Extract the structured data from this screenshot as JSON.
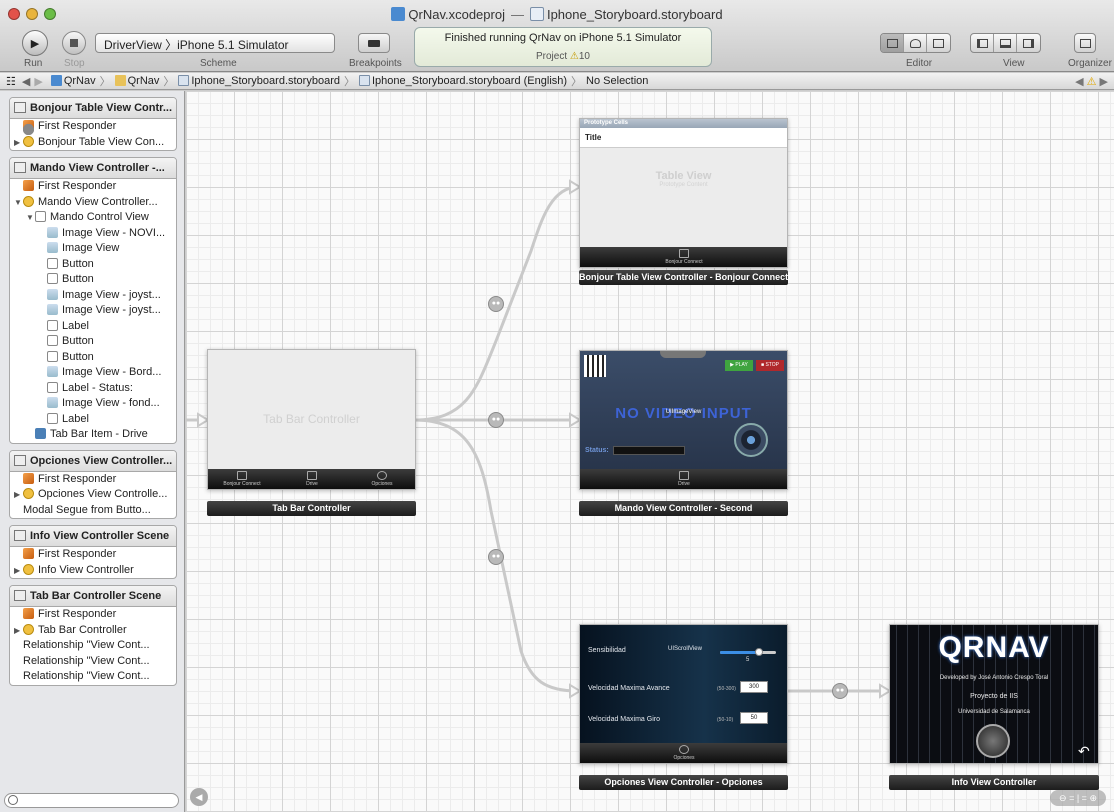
{
  "window": {
    "title_project": "QrNav.xcodeproj",
    "title_separator": "—",
    "title_file": "Iphone_Storyboard.storyboard"
  },
  "toolbar": {
    "run_label": "Run",
    "stop_label": "Stop",
    "scheme_value": "DriverView 〉iPhone 5.1 Simulator",
    "scheme_label": "Scheme",
    "breakpoints_label": "Breakpoints",
    "activity_status": "Finished running QrNav on iPhone 5.1 Simulator",
    "activity_project": "Project",
    "activity_warnings": "10",
    "editor_label": "Editor",
    "view_label": "View",
    "organizer_label": "Organizer"
  },
  "jumpbar": {
    "items": [
      "QrNav",
      "QrNav",
      "Iphone_Storyboard.storyboard",
      "Iphone_Storyboard.storyboard (English)",
      "No Selection"
    ]
  },
  "outline": [
    {
      "title": "Bonjour Table View Contr...",
      "rows": [
        {
          "label": "First Responder",
          "icon": "cube",
          "indent": 0,
          "disclosure": ""
        },
        {
          "label": "Bonjour Table View Con...",
          "icon": "circle",
          "indent": 0,
          "disclosure": "▶"
        }
      ]
    },
    {
      "title": "Mando View Controller -...",
      "rows": [
        {
          "label": "First Responder",
          "icon": "cube",
          "indent": 0,
          "disclosure": ""
        },
        {
          "label": "Mando View Controller...",
          "icon": "circle",
          "indent": 0,
          "disclosure": "▼"
        },
        {
          "label": "Mando Control View",
          "icon": "box",
          "indent": 1,
          "disclosure": "▼"
        },
        {
          "label": "Image View - NOVI...",
          "icon": "image",
          "indent": 2,
          "disclosure": ""
        },
        {
          "label": "Image View",
          "icon": "image",
          "indent": 2,
          "disclosure": ""
        },
        {
          "label": "Button",
          "icon": "box",
          "indent": 2,
          "disclosure": ""
        },
        {
          "label": "Button",
          "icon": "box",
          "indent": 2,
          "disclosure": ""
        },
        {
          "label": "Image View - joyst...",
          "icon": "image",
          "indent": 2,
          "disclosure": ""
        },
        {
          "label": "Image View - joyst...",
          "icon": "image",
          "indent": 2,
          "disclosure": ""
        },
        {
          "label": "Label",
          "icon": "box",
          "indent": 2,
          "disclosure": ""
        },
        {
          "label": "Button",
          "icon": "box",
          "indent": 2,
          "disclosure": ""
        },
        {
          "label": "Button",
          "icon": "box",
          "indent": 2,
          "disclosure": ""
        },
        {
          "label": "Image View - Bord...",
          "icon": "image",
          "indent": 2,
          "disclosure": ""
        },
        {
          "label": "Label - Status:",
          "icon": "box",
          "indent": 2,
          "disclosure": ""
        },
        {
          "label": "Image View - fond...",
          "icon": "image",
          "indent": 2,
          "disclosure": ""
        },
        {
          "label": "Label",
          "icon": "box",
          "indent": 2,
          "disclosure": ""
        },
        {
          "label": "Tab Bar Item - Drive",
          "icon": "tab",
          "indent": 1,
          "disclosure": ""
        }
      ]
    },
    {
      "title": "Opciones View Controller...",
      "rows": [
        {
          "label": "First Responder",
          "icon": "cube",
          "indent": 0,
          "disclosure": ""
        },
        {
          "label": "Opciones View Controlle...",
          "icon": "circle",
          "indent": 0,
          "disclosure": "▶"
        },
        {
          "label": "Modal Segue from Butto...",
          "icon": "segue",
          "indent": 0,
          "disclosure": ""
        }
      ]
    },
    {
      "title": "Info View Controller Scene",
      "rows": [
        {
          "label": "First Responder",
          "icon": "cube",
          "indent": 0,
          "disclosure": ""
        },
        {
          "label": "Info View Controller",
          "icon": "circle",
          "indent": 0,
          "disclosure": "▶"
        }
      ]
    },
    {
      "title": "Tab Bar Controller Scene",
      "rows": [
        {
          "label": "First Responder",
          "icon": "cube",
          "indent": 0,
          "disclosure": ""
        },
        {
          "label": "Tab Bar Controller",
          "icon": "circle",
          "indent": 0,
          "disclosure": "▶"
        },
        {
          "label": "Relationship \"View Cont...",
          "icon": "segue",
          "indent": 0,
          "disclosure": ""
        },
        {
          "label": "Relationship \"View Cont...",
          "icon": "segue",
          "indent": 0,
          "disclosure": ""
        },
        {
          "label": "Relationship \"View Cont...",
          "icon": "segue",
          "indent": 0,
          "disclosure": ""
        }
      ]
    }
  ],
  "canvas": {
    "bonjour": {
      "section_header": "Prototype Cells",
      "cell_title": "Title",
      "placeholder_title": "Table View",
      "placeholder_sub": "Prototype Content",
      "tab_label": "Bonjour Connect",
      "dock_label": "Bonjour Table View Controller - Bonjour Connect"
    },
    "tabbar": {
      "placeholder": "Tab Bar Controller",
      "items": [
        "Bonjour Connect",
        "Drive",
        "Opciones"
      ],
      "dock_label": "Tab Bar Controller"
    },
    "mando": {
      "video_text": "NO VIDEO INPUT",
      "imageview_label": "UIImageView",
      "play_label": "PLAY",
      "stop_label": "STOP",
      "status_label": "Status:",
      "tab_label": "Drive",
      "dock_label": "Mando View Controller - Second"
    },
    "opciones": {
      "scroll_label": "UIScrollView",
      "rows": [
        {
          "label": "Sensibilidad",
          "value": "5"
        },
        {
          "label": "Velocidad Maxima Avance",
          "range": "(50-300)",
          "value": "300"
        },
        {
          "label": "Velocidad Maxima Giro",
          "range": "(50-10)",
          "value": "50"
        }
      ],
      "slider_value": 0.7,
      "tab_label": "Opciones",
      "dock_label": "Opciones View Controller - Opciones"
    },
    "info": {
      "logo": "QRNAV",
      "lines": [
        "Developed by José Antonio Crespo Toral",
        "Proyecto de IIS",
        "Universidad de Salamanca"
      ],
      "dock_label": "Info View Controller"
    },
    "zoom_label": "= | ="
  },
  "colors": {
    "accent_green": "#3fa43f",
    "accent_red": "#b0282c",
    "mando_bg": "#2f3d56",
    "opciones_bg": "#0b1a2a",
    "info_bg": "#0b0d12"
  }
}
